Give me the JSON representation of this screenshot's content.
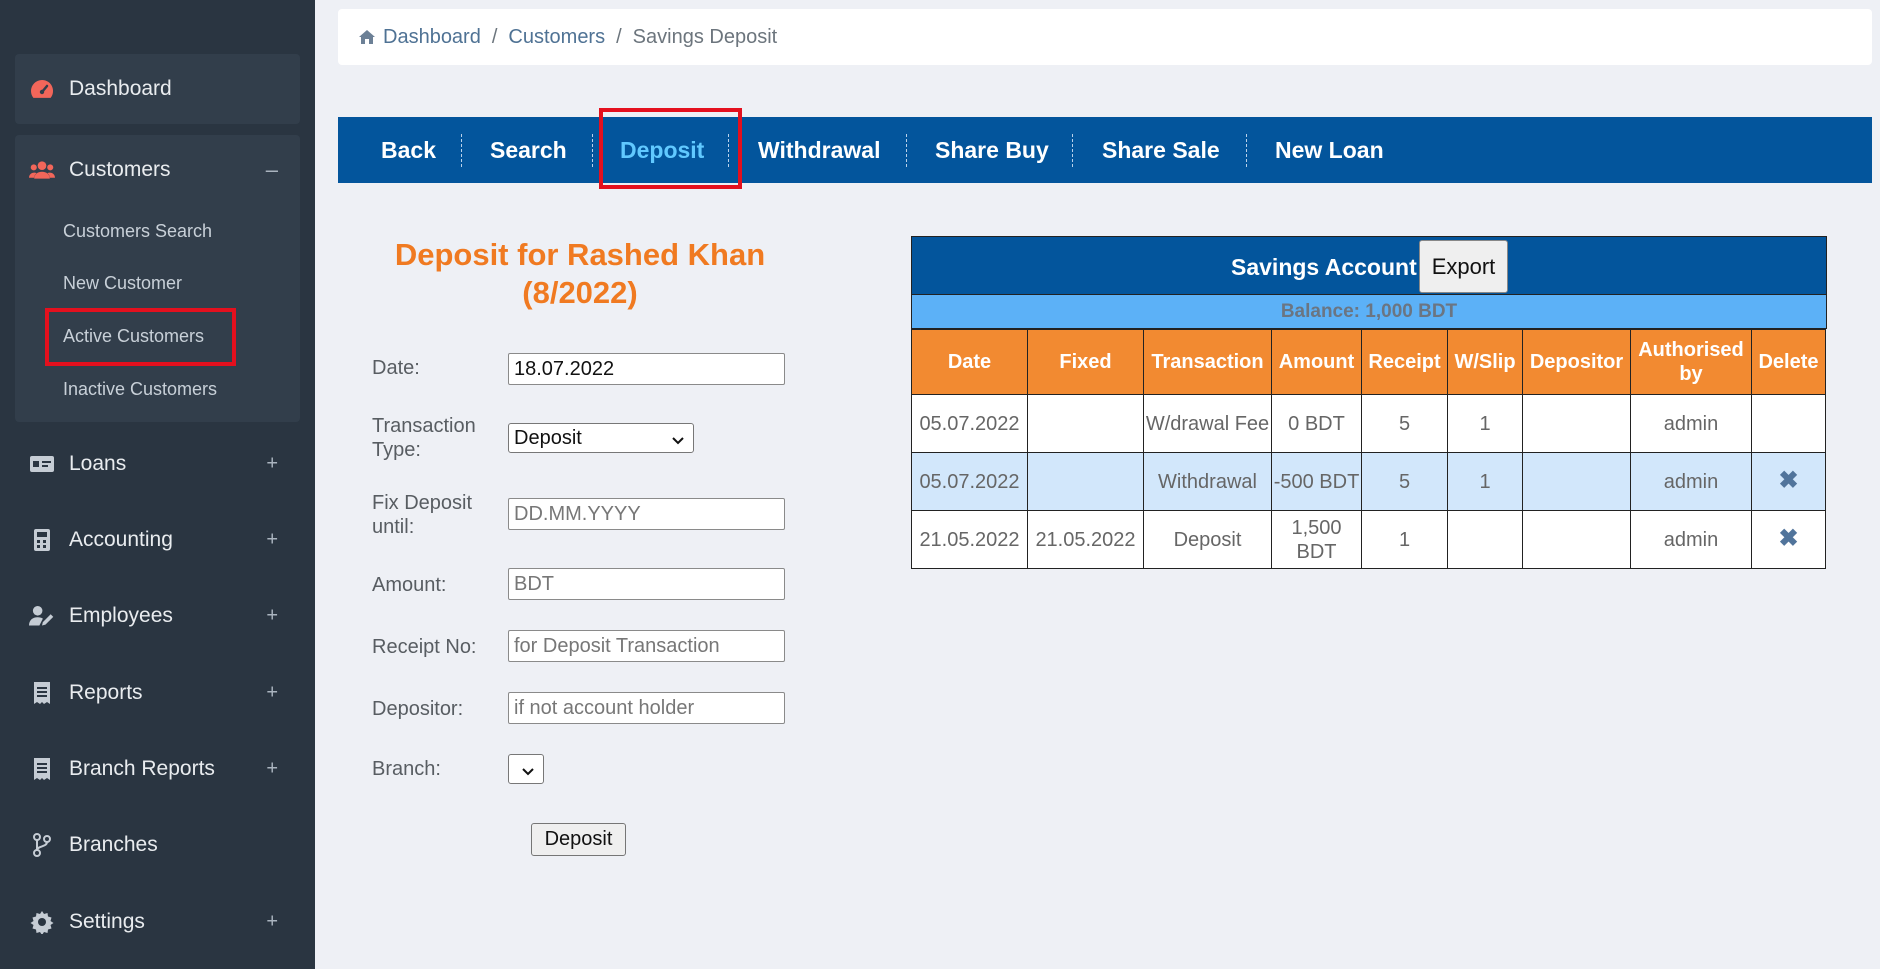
{
  "sidebar": {
    "dashboard": "Dashboard",
    "customers": "Customers",
    "customers_toggle": "–",
    "customers_sub": [
      "Customers Search",
      "New Customer",
      "Active Customers",
      "Inactive Customers"
    ],
    "items": [
      {
        "label": "Loans",
        "icon": "money-icon"
      },
      {
        "label": "Accounting",
        "icon": "calculator-icon"
      },
      {
        "label": "Employees",
        "icon": "user-edit-icon"
      },
      {
        "label": "Reports",
        "icon": "receipt-icon"
      },
      {
        "label": "Branch Reports",
        "icon": "receipt-icon"
      },
      {
        "label": "Branches",
        "icon": "branch-icon"
      },
      {
        "label": "Settings",
        "icon": "gear-icon"
      }
    ],
    "plus": "+"
  },
  "breadcrumb": {
    "items": [
      "Dashboard",
      "Customers",
      "Savings Deposit"
    ],
    "sep": "/"
  },
  "tabs": [
    "Back",
    "Search",
    "Deposit",
    "Withdrawal",
    "Share Buy",
    "Share Sale",
    "New Loan"
  ],
  "form": {
    "title": "Deposit for Rashed Khan (8/2022)",
    "date_label": "Date:",
    "date_value": "18.07.2022",
    "type_label": "Transaction Type:",
    "type_value": "Deposit",
    "fix_label": "Fix Deposit until:",
    "fix_placeholder": "DD.MM.YYYY",
    "amount_label": "Amount:",
    "amount_placeholder": "BDT",
    "receipt_label": "Receipt No:",
    "receipt_placeholder": "for Deposit Transaction",
    "depositor_label": "Depositor:",
    "depositor_placeholder": "if not account holder",
    "branch_label": "Branch:",
    "submit": "Deposit"
  },
  "account": {
    "title": "Savings Account",
    "export": "Export",
    "balance": "Balance: 1,000 BDT",
    "headers": [
      "Date",
      "Fixed",
      "Transaction",
      "Amount",
      "Receipt",
      "W/Slip",
      "Depositor",
      "Authorised by",
      "Delete"
    ],
    "rows": [
      [
        "05.07.2022",
        "",
        "W/drawal Fee",
        "0 BDT",
        "5",
        "1",
        "",
        "admin",
        ""
      ],
      [
        "05.07.2022",
        "",
        "Withdrawal",
        "-500 BDT",
        "5",
        "1",
        "",
        "admin",
        "✖"
      ],
      [
        "21.05.2022",
        "21.05.2022",
        "Deposit",
        "1,500 BDT",
        "1",
        "",
        "",
        "admin",
        "✖"
      ]
    ]
  },
  "colors": {
    "sidebar": "#2a3541",
    "tabs": "#03559c",
    "accent_orange": "#f28a31",
    "balance": "#5cb1f7",
    "highlight": "#e4101e"
  }
}
